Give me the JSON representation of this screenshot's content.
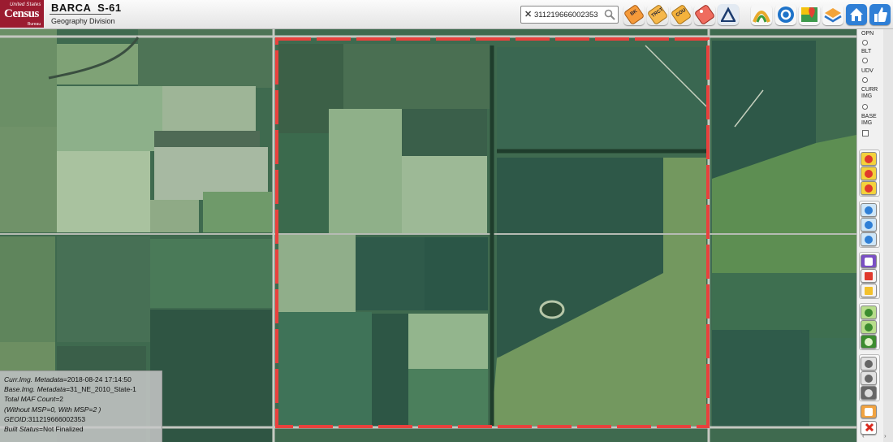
{
  "header": {
    "logo": {
      "small": "United States",
      "big": "Census",
      "bureau": "Bureau"
    },
    "app_title": "BARCA  S-61",
    "subtitle": "Geography Division"
  },
  "search": {
    "value": "311219666002353",
    "clear_glyph": "✕"
  },
  "toolbar": {
    "tools": [
      {
        "name": "bk-tool-button",
        "label": "BK",
        "color": "#f59a3a"
      },
      {
        "name": "trct-tool-button",
        "label": "TRCT",
        "color": "#f6b84b"
      },
      {
        "name": "cou-tool-button",
        "label": "COU",
        "color": "#f4b23c"
      },
      {
        "name": "tag-tool-button",
        "label": "",
        "color": "#ef6c5f"
      },
      {
        "name": "measure-tool-button",
        "label": "",
        "color": "#dfe7f0"
      },
      {
        "name": "curve-tool-button",
        "label": "",
        "color": "#f5f5f5"
      },
      {
        "name": "bing-tool-button",
        "label": "",
        "color": "#f5f5f5"
      },
      {
        "name": "google-maps-button",
        "label": "",
        "color": "#f5f5f5"
      },
      {
        "name": "layers-button",
        "label": "",
        "color": "#f5f5f5"
      },
      {
        "name": "home-button",
        "label": "",
        "color": "#2f7fd6"
      },
      {
        "name": "thumbs-up-button",
        "label": "",
        "color": "#2f7fd6"
      }
    ]
  },
  "right_panel": {
    "options": [
      {
        "label": "OPN",
        "type": "radio"
      },
      {
        "label": "BLT",
        "type": "radio"
      },
      {
        "label": "UDV",
        "type": "radio"
      },
      {
        "label": "CURR IMG",
        "type": "radio"
      },
      {
        "label": "BASE IMG",
        "type": "checkbox"
      }
    ],
    "scroll_left": "‹",
    "scroll_right": "›"
  },
  "info": {
    "curr_key": "Curr.Img. Metadata",
    "curr_value": "=2018-08-24 17:14:50",
    "base_key": "Base.Img. Metadata",
    "base_value": "=31_NE_2010_State-1",
    "maf_key": "Total MAF Count",
    "maf_value": "=2",
    "msp_line": "(Without MSP=0, With MSP=2 )",
    "geoid_key": "GEOID",
    "geoid_value": ":311219666002353",
    "built_key": "Built Status",
    "built_value": "=Not Finalized"
  },
  "colors": {
    "boundary": "#e8413d",
    "logo": "#9b1b30",
    "field_dark": "#2f5a4a",
    "field_light": "#8fae8a"
  }
}
